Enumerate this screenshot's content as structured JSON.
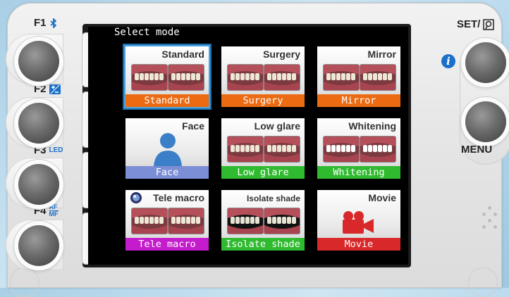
{
  "screen": {
    "title": "Select mode"
  },
  "function_keys": {
    "f1": {
      "label": "F1",
      "icon": "bluetooth-icon"
    },
    "f2": {
      "label": "F2",
      "icon": "plus-minus-icon"
    },
    "f3": {
      "label": "F3",
      "icon_text": "LED"
    },
    "f4": {
      "label": "F4",
      "icon_text_top": "AF",
      "icon_text_bottom": "MF"
    }
  },
  "right_keys": {
    "set_label": "SET/",
    "menu_label": "MENU",
    "info_icon": "info-icon"
  },
  "side_tabs": [
    {
      "icon": "clear-icon"
    },
    {
      "icon": "up-arrow-icon"
    },
    {
      "icon": "down-arrow-icon"
    },
    {
      "icon": "list-icon"
    }
  ],
  "modes": [
    {
      "name": "Standard",
      "bar": "Standard",
      "bar_color": "#ec6a12",
      "selected": true
    },
    {
      "name": "Surgery",
      "bar": "Surgery",
      "bar_color": "#ec6a12",
      "selected": false
    },
    {
      "name": "Mirror",
      "bar": "Mirror",
      "bar_color": "#ec6a12",
      "selected": false
    },
    {
      "name": "Face",
      "bar": "Face",
      "bar_color": "#7c8fd6",
      "selected": false
    },
    {
      "name": "Low glare",
      "bar": "Low glare",
      "bar_color": "#2fba2f",
      "selected": false
    },
    {
      "name": "Whitening",
      "bar": "Whitening",
      "bar_color": "#2fba2f",
      "selected": false
    },
    {
      "name": "Tele macro",
      "bar": "Tele macro",
      "bar_color": "#c41ccc",
      "selected": false
    },
    {
      "name": "Isolate shade",
      "bar": "Isolate shade",
      "bar_color": "#2fba2f",
      "selected": false
    },
    {
      "name": "Movie",
      "bar": "Movie",
      "bar_color": "#d9282a",
      "selected": false
    }
  ],
  "colors": {
    "accent": "#1e6fa9",
    "info_blue": "#1a6fc8"
  }
}
